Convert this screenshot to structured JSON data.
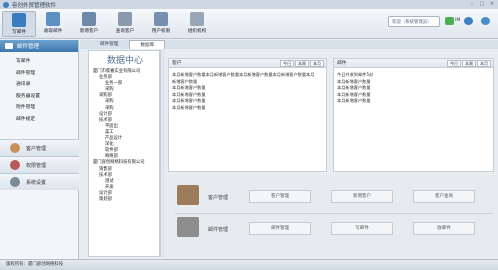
{
  "app": {
    "title": "容创外贸管理软件"
  },
  "toolbar": {
    "items": [
      {
        "label": "写邮件",
        "icon": "compose-mail-icon",
        "color": "#3b7bbf"
      },
      {
        "label": "收取邮件",
        "icon": "receive-mail-icon",
        "color": "#5d8fc4"
      },
      {
        "label": "新增客户",
        "icon": "add-customer-icon",
        "color": "#6f8aa8"
      },
      {
        "label": "查询客户",
        "icon": "search-customer-icon",
        "color": "#8a99ab"
      },
      {
        "label": "用户权限",
        "icon": "user-permission-icon",
        "color": "#7690b0"
      },
      {
        "label": "组织机构",
        "icon": "organization-icon",
        "color": "#98a6b6"
      }
    ],
    "welcome": "欢迎（系统管理员）",
    "right_items": [
      {
        "label": "IM",
        "icon": "im-chat-icon",
        "color": "#4caf50"
      },
      {
        "label": "",
        "icon": "settings-gear-icon",
        "color": "#3d7fc1"
      },
      {
        "label": "",
        "icon": "help-icon",
        "color": "#4a8ed0"
      }
    ]
  },
  "sidebar": {
    "title": "邮件管理",
    "items": [
      "写邮件",
      "邮件管理",
      "通讯录",
      "服务器设置",
      "附件管理",
      "邮件规定"
    ],
    "groups": [
      {
        "label": "客户管理",
        "icon": "customer-icon",
        "color": "#c9905a"
      },
      {
        "label": "权限管理",
        "icon": "permission-icon",
        "color": "#b85a5a"
      },
      {
        "label": "系统设置",
        "icon": "system-settings-icon",
        "color": "#7a8a9a"
      }
    ]
  },
  "tabs": [
    "邮件管理",
    "数据库"
  ],
  "data_center": {
    "title": "数据中心",
    "tree": [
      {
        "text": "厦门市蔡嘉实业有限公司",
        "level": 0
      },
      {
        "text": "业务部",
        "level": 1
      },
      {
        "text": "业务一部",
        "level": 2
      },
      {
        "text": "采购",
        "level": 2
      },
      {
        "text": "采购部",
        "level": 1
      },
      {
        "text": "采购",
        "level": 2
      },
      {
        "text": "采购",
        "level": 2
      },
      {
        "text": "设计部",
        "level": 1
      },
      {
        "text": "技术部",
        "level": 1
      },
      {
        "text": "平面出",
        "level": 2
      },
      {
        "text": "美工",
        "level": 2
      },
      {
        "text": "产品设计",
        "level": 2
      },
      {
        "text": "深化",
        "level": 2
      },
      {
        "text": "软件部",
        "level": 2
      },
      {
        "text": "网络部",
        "level": 2
      },
      {
        "text": "厦门容创网络科技有限公司",
        "level": 0
      },
      {
        "text": "销售部",
        "level": 1
      },
      {
        "text": "技术部",
        "level": 1
      },
      {
        "text": "测试",
        "level": 2
      },
      {
        "text": "开发",
        "level": 2
      },
      {
        "text": "设计部",
        "level": 1
      },
      {
        "text": "策划部",
        "level": 1
      }
    ]
  },
  "customer_panel": {
    "title": "客户",
    "buttons": [
      "今日",
      "本周",
      "本月"
    ],
    "lines": [
      "本月新增客户数量本月新增客户数量本月新增客户数量本月新增客户数量本月",
      "新增客户数量",
      "本月新增客户数量",
      "本月新增客户数量",
      "本月新增客户数量",
      "本月新增客户数量"
    ]
  },
  "mail_panel": {
    "title": "邮件",
    "buttons": [
      "今日",
      "本周",
      "本月"
    ],
    "lines": [
      "今日共收到邮件5封",
      "本月新增客户数量",
      "本月新增客户数量",
      "本月新增客户数量",
      "本月新增客户数量"
    ]
  },
  "modules": [
    {
      "label": "客户管理",
      "icon": "customer-module-icon",
      "color": "#9c7b5a",
      "buttons": [
        "客户管理",
        "新增客户",
        "客户查询"
      ]
    },
    {
      "label": "邮件管理",
      "icon": "mail-module-icon",
      "color": "#8d8d8d",
      "buttons": [
        "邮件管理",
        "写邮件",
        "收邮件"
      ]
    }
  ],
  "status": {
    "text": "版权所有：厦门容创网络科技"
  }
}
